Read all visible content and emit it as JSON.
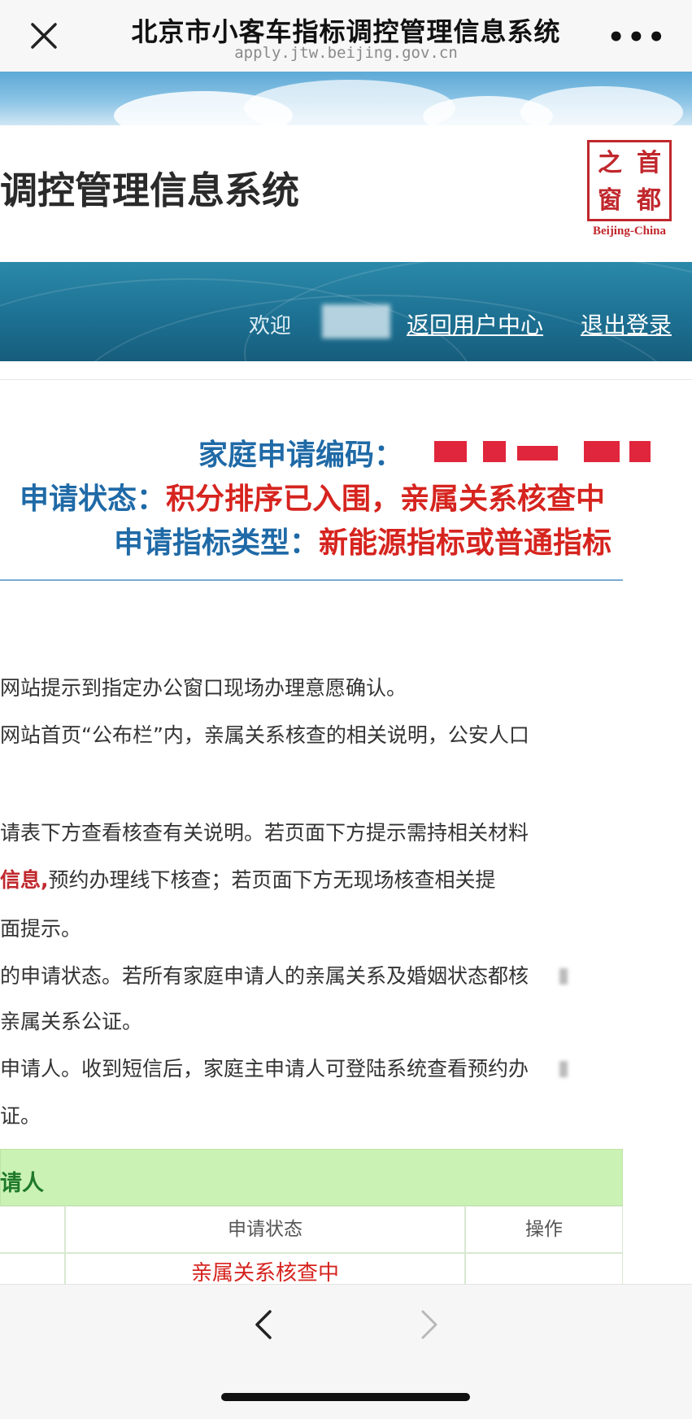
{
  "browser": {
    "title": "北京市小客车指标调控管理信息系统",
    "url": "apply.jtw.beijing.gov.cn",
    "more_label": "•••",
    "close_icon": "close-icon"
  },
  "header": {
    "system_title": "调控管理信息系统",
    "logo": {
      "chars": [
        "之",
        "首",
        "窗",
        "都"
      ],
      "subtitle": "Beijing-China"
    },
    "welcome": "欢迎",
    "links": {
      "user_center": "返回用户中心",
      "logout": "退出登录"
    }
  },
  "status": {
    "code_label": "家庭申请编码：",
    "state_label": "申请状态：",
    "state_value": "积分排序已入围，亲属关系核查中",
    "type_label": "申请指标类型：",
    "type_value": "新能源指标或普通指标"
  },
  "notes": [
    "网站提示到指定办公窗口现场办理意愿确认。",
    "网站首页“公布栏”内，亲属关系核查的相关说明，公安人口",
    "请表下方查看核查有关说明。若页面下方提示需持相关材料",
    {
      "red": "信息,",
      "rest": "预约办理线下核查；若页面下方无现场核查相关提"
    },
    "面提示。",
    "的申请状态。若所有家庭申请人的亲属关系及婚姻状态都核",
    "亲属关系公证。",
    "申请人。收到短信后，家庭主申请人可登陆系统查看预约办",
    "证。"
  ],
  "table": {
    "title": "请人",
    "headers": [
      "申请状态",
      "操作"
    ],
    "row_status": "亲属关系核查中"
  },
  "colors": {
    "label_blue": "#1f6aa7",
    "value_red": "#d6241f",
    "nav_teal": "#1c6f91",
    "table_head_green": "#cbf2b5"
  }
}
